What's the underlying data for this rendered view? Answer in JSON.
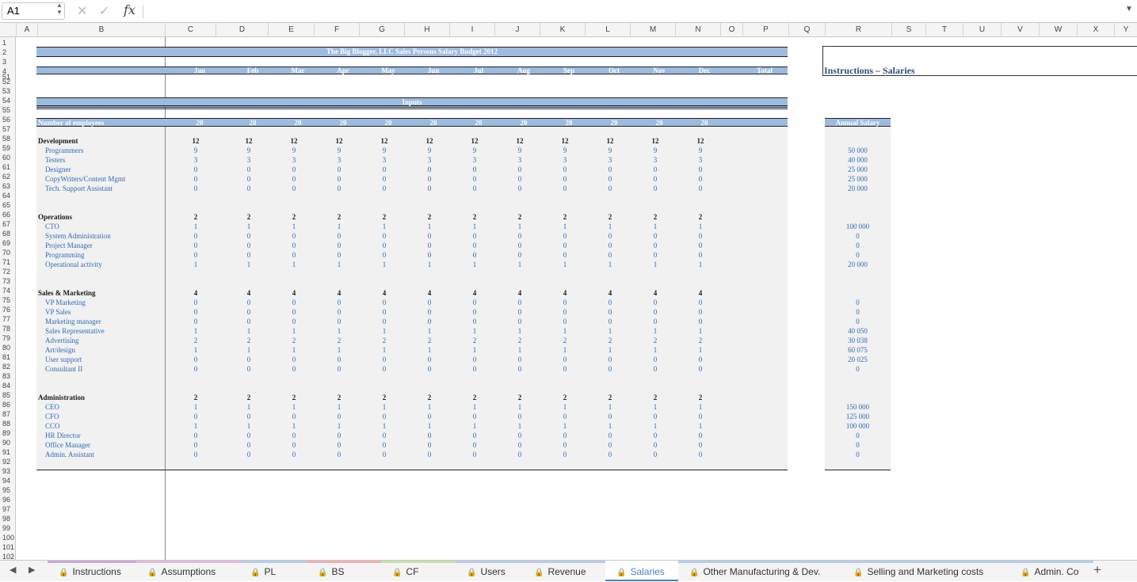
{
  "formula_bar": {
    "name_box": "A1",
    "formula": ""
  },
  "columns": [
    "A",
    "B",
    "C",
    "D",
    "E",
    "F",
    "G",
    "H",
    "I",
    "J",
    "K",
    "L",
    "M",
    "N",
    "O",
    "P",
    "Q",
    "R",
    "S",
    "T",
    "U",
    "V",
    "W",
    "X",
    "Y"
  ],
  "rows": [
    "1",
    "2",
    "3",
    "4",
    "51",
    "52",
    "53",
    "54",
    "55",
    "56",
    "57",
    "58",
    "59",
    "60",
    "61",
    "62",
    "63",
    "64",
    "65",
    "66",
    "67",
    "68",
    "69",
    "70",
    "71",
    "72",
    "73",
    "74",
    "75",
    "76",
    "77",
    "78",
    "79",
    "80",
    "81",
    "82",
    "83",
    "84",
    "85",
    "86",
    "87",
    "88",
    "89",
    "90",
    "91",
    "92",
    "93",
    "94",
    "95",
    "96",
    "97",
    "98",
    "99",
    "100",
    "101",
    "102"
  ],
  "sheet": {
    "title": "The Big Blogger, LLC Sales Persons Salary Budget 2012",
    "months": [
      "Jan",
      "Feb",
      "Mar",
      "Apr",
      "May",
      "Jun",
      "Jul",
      "Aug",
      "Sep",
      "Oct",
      "Nov",
      "Dec"
    ],
    "total_label": "Total",
    "inputs_label": "Inputs",
    "employees_label": "Number of employees",
    "employees_values": [
      "20",
      "20",
      "20",
      "20",
      "20",
      "20",
      "20",
      "20",
      "20",
      "20",
      "20",
      "20"
    ],
    "annual_salary_label": "Annual Salary",
    "instructions_title": "Instructions – Salaries",
    "sections": [
      {
        "name": "Development",
        "totals": "12",
        "rows": [
          {
            "label": "Programmers",
            "v": "9",
            "salary": "50 000"
          },
          {
            "label": "Testers",
            "v": "3",
            "salary": "40 000"
          },
          {
            "label": "Designer",
            "v": "0",
            "salary": "25 000"
          },
          {
            "label": "CopyWriters/Content Mgmt",
            "v": "0",
            "salary": "25 000"
          },
          {
            "label": "Tech. Support Assistant",
            "v": "0",
            "salary": "20 000"
          }
        ]
      },
      {
        "name": "Operations",
        "totals": "2",
        "rows": [
          {
            "label": "CTO",
            "v": "1",
            "salary": "100 000"
          },
          {
            "label": "System Administration",
            "v": "0",
            "salary": "0"
          },
          {
            "label": "Project Manager",
            "v": "0",
            "salary": "0"
          },
          {
            "label": "Programming",
            "v": "0",
            "salary": "0"
          },
          {
            "label": "Operational activity",
            "v": "1",
            "salary": "20 000"
          }
        ]
      },
      {
        "name": "Sales & Marketing",
        "totals": "4",
        "rows": [
          {
            "label": "VP Marketing",
            "v": "0",
            "salary": "0"
          },
          {
            "label": "VP Sales",
            "v": "0",
            "salary": "0"
          },
          {
            "label": "Marketing manager",
            "v": "0",
            "salary": "0"
          },
          {
            "label": "Sales Representative",
            "v": "1",
            "salary": "40 050"
          },
          {
            "label": "Advertising",
            "v": "2",
            "salary": "30 038"
          },
          {
            "label": "Art/design",
            "v": "1",
            "salary": "60 075"
          },
          {
            "label": "User support",
            "v": "0",
            "salary": "20 025"
          },
          {
            "label": "Consultant II",
            "v": "0",
            "salary": "0"
          }
        ]
      },
      {
        "name": "Administration",
        "totals": "2",
        "rows": [
          {
            "label": "CEO",
            "v": "1",
            "salary": "150 000"
          },
          {
            "label": "CFO",
            "v": "0",
            "salary": "125 000"
          },
          {
            "label": "CCO",
            "v": "1",
            "salary": "100 000"
          },
          {
            "label": "HR Director",
            "v": "0",
            "salary": "0"
          },
          {
            "label": "Office Manager",
            "v": "0",
            "salary": "0"
          },
          {
            "label": "Admin. Assistant",
            "v": "0",
            "salary": "0"
          }
        ]
      }
    ]
  },
  "tabs": [
    "Instructions",
    "Assumptions",
    "PL",
    "BS",
    "CF",
    "Users",
    "Revenue",
    "Salaries",
    "Other Manufacturing & Dev.",
    "Selling and Marketing costs",
    "Admin. Co"
  ],
  "active_tab": "Salaries",
  "tab_colors": [
    "#c9a8d8",
    "#e7b8d8",
    "#b8cce8",
    "#f0b0b0",
    "#c8e0a8",
    "#b8cce8",
    "#b8cce8",
    "#b8cce8",
    "#b8cce8",
    "#b8cce8",
    "#b8cce8"
  ]
}
